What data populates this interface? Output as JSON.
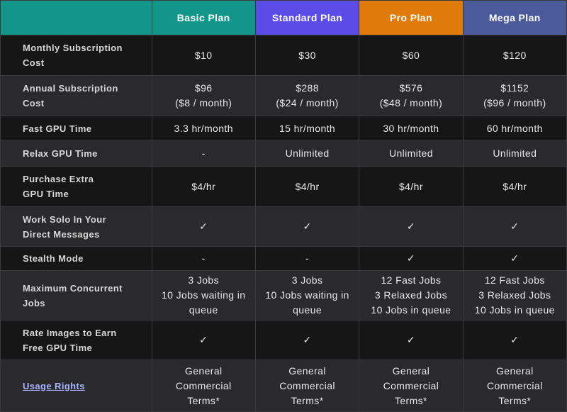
{
  "colors": {
    "corner": "#13968a",
    "basic": "#13968a",
    "standard": "#5b4ce8",
    "pro": "#e07a08",
    "mega": "#4a5a9a",
    "row_dark": "#161616",
    "row_light": "#2a2a2c",
    "link": "#a8b4ff"
  },
  "plans": [
    {
      "name": "Basic Plan",
      "color": "#13968a"
    },
    {
      "name": "Standard Plan",
      "color": "#5b4ce8"
    },
    {
      "name": "Pro Plan",
      "color": "#e07a08"
    },
    {
      "name": "Mega Plan",
      "color": "#4a5a9a"
    }
  ],
  "rows": [
    {
      "feature": [
        "Monthly Subscription",
        "Cost"
      ],
      "values": [
        [
          "$10"
        ],
        [
          "$30"
        ],
        [
          "$60"
        ],
        [
          "$120"
        ]
      ]
    },
    {
      "feature": [
        "Annual Subscription",
        "Cost"
      ],
      "values": [
        [
          "$96",
          "($8 / month)"
        ],
        [
          "$288",
          "($24 / month)"
        ],
        [
          "$576",
          "($48 / month)"
        ],
        [
          "$1152",
          "($96 / month)"
        ]
      ]
    },
    {
      "feature": [
        "Fast GPU Time"
      ],
      "values": [
        [
          "3.3 hr/month"
        ],
        [
          "15 hr/month"
        ],
        [
          "30 hr/month"
        ],
        [
          "60 hr/month"
        ]
      ]
    },
    {
      "feature": [
        "Relax GPU Time"
      ],
      "values": [
        [
          "-"
        ],
        [
          "Unlimited"
        ],
        [
          "Unlimited"
        ],
        [
          "Unlimited"
        ]
      ]
    },
    {
      "feature": [
        "Purchase Extra",
        "GPU Time"
      ],
      "values": [
        [
          "$4/hr"
        ],
        [
          "$4/hr"
        ],
        [
          "$4/hr"
        ],
        [
          "$4/hr"
        ]
      ]
    },
    {
      "feature": [
        "Work Solo In Your",
        "Direct Messages"
      ],
      "values": [
        [
          "✓"
        ],
        [
          "✓"
        ],
        [
          "✓"
        ],
        [
          "✓"
        ]
      ]
    },
    {
      "feature": [
        "Stealth Mode"
      ],
      "values": [
        [
          "-"
        ],
        [
          "-"
        ],
        [
          "✓"
        ],
        [
          "✓"
        ]
      ]
    },
    {
      "feature": [
        "Maximum Concurrent",
        "Jobs"
      ],
      "values": [
        [
          "3 Jobs",
          "10 Jobs waiting in",
          "queue"
        ],
        [
          "3 Jobs",
          "10 Jobs waiting in",
          "queue"
        ],
        [
          "12 Fast Jobs",
          "3 Relaxed Jobs",
          "10 Jobs in queue"
        ],
        [
          "12 Fast Jobs",
          "3 Relaxed Jobs",
          "10 Jobs in queue"
        ]
      ]
    },
    {
      "feature": [
        "Rate Images to Earn",
        "Free GPU Time"
      ],
      "values": [
        [
          "✓"
        ],
        [
          "✓"
        ],
        [
          "✓"
        ],
        [
          "✓"
        ]
      ]
    },
    {
      "feature": [
        "Usage Rights"
      ],
      "feature_is_link": true,
      "values": [
        [
          "General",
          "Commercial",
          "Terms*"
        ],
        [
          "General",
          "Commercial",
          "Terms*"
        ],
        [
          "General",
          "Commercial",
          "Terms*"
        ],
        [
          "General",
          "Commercial",
          "Terms*"
        ]
      ]
    }
  ]
}
